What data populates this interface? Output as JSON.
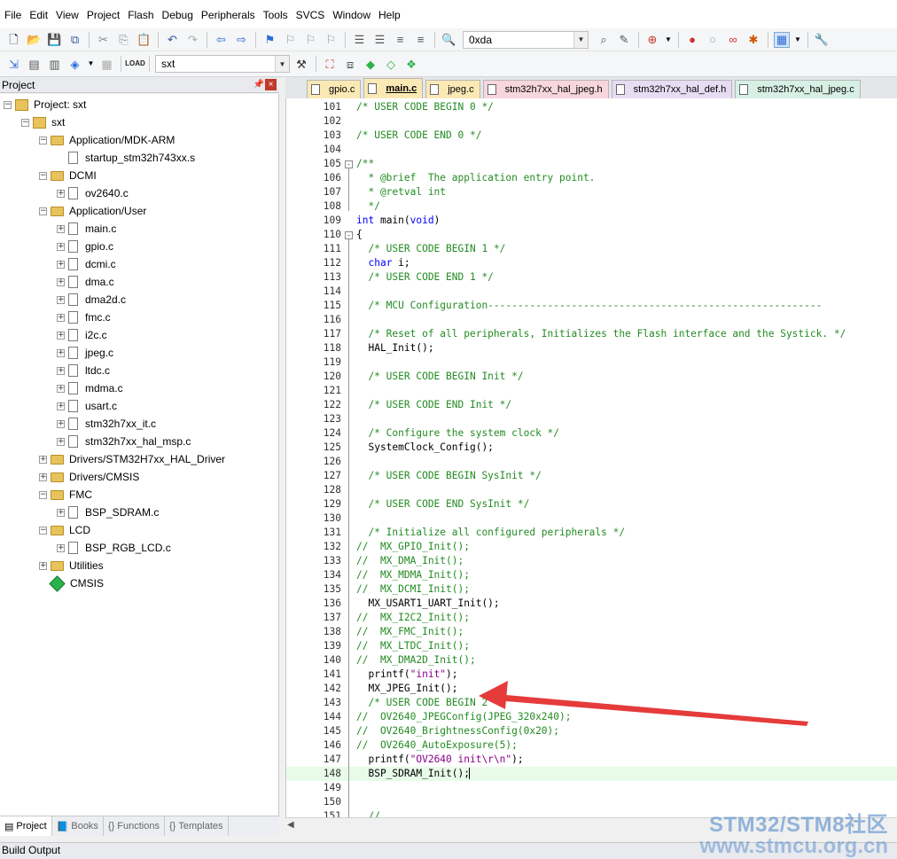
{
  "menu": [
    "File",
    "Edit",
    "View",
    "Project",
    "Flash",
    "Debug",
    "Peripherals",
    "Tools",
    "SVCS",
    "Window",
    "Help"
  ],
  "toolbar": {
    "search_value": "0xda",
    "target_value": "sxt"
  },
  "project_panel": {
    "title": "Project",
    "root": "Project: sxt",
    "target": "sxt",
    "groups": [
      {
        "name": "Application/MDK-ARM",
        "files": [
          "startup_stm32h743xx.s"
        ]
      },
      {
        "name": "DCMI",
        "files": [
          "ov2640.c"
        ]
      },
      {
        "name": "Application/User",
        "files": [
          "main.c",
          "gpio.c",
          "dcmi.c",
          "dma.c",
          "dma2d.c",
          "fmc.c",
          "i2c.c",
          "jpeg.c",
          "ltdc.c",
          "mdma.c",
          "usart.c",
          "stm32h7xx_it.c",
          "stm32h7xx_hal_msp.c"
        ]
      },
      {
        "name": "Drivers/STM32H7xx_HAL_Driver",
        "files": []
      },
      {
        "name": "Drivers/CMSIS",
        "files": []
      },
      {
        "name": "FMC",
        "files": [
          "BSP_SDRAM.c"
        ]
      },
      {
        "name": "LCD",
        "files": [
          "BSP_RGB_LCD.c"
        ]
      },
      {
        "name": "Utilities",
        "files": []
      }
    ],
    "cmsis": "CMSIS",
    "tabs": [
      "Project",
      "Books",
      "Functions",
      "Templates"
    ]
  },
  "build_output": "Build Output",
  "editor_tabs": [
    {
      "label": "gpio.c",
      "color": "#fbe9b5"
    },
    {
      "label": "main.c",
      "color": "#fbe9b5",
      "active": true
    },
    {
      "label": "jpeg.c",
      "color": "#fbe9b5"
    },
    {
      "label": "stm32h7xx_hal_jpeg.h",
      "color": "#f7d6de"
    },
    {
      "label": "stm32h7xx_hal_def.h",
      "color": "#e8dcf3"
    },
    {
      "label": "stm32h7xx_hal_jpeg.c",
      "color": "#d8efe5"
    }
  ],
  "code_lines": [
    {
      "n": "101",
      "t": "/* USER CODE BEGIN 0 */",
      "k": "com"
    },
    {
      "n": "102",
      "t": "",
      "k": "plain"
    },
    {
      "n": "103",
      "t": "/* USER CODE END 0 */",
      "k": "com"
    },
    {
      "n": "104",
      "t": "",
      "k": "plain"
    },
    {
      "n": "105",
      "t": "/**",
      "k": "com",
      "fold": "-"
    },
    {
      "n": "106",
      "t": "  * @brief  The application entry point.",
      "k": "com"
    },
    {
      "n": "107",
      "t": "  * @retval int",
      "k": "com"
    },
    {
      "n": "108",
      "t": "  */",
      "k": "com"
    },
    {
      "n": "109",
      "t": "int main(void)",
      "k": "mixmain"
    },
    {
      "n": "110",
      "t": "{",
      "k": "plain",
      "fold": "-"
    },
    {
      "n": "111",
      "t": "  /* USER CODE BEGIN 1 */",
      "k": "com"
    },
    {
      "n": "112",
      "t": "  char i;",
      "k": "mixchar"
    },
    {
      "n": "113",
      "t": "  /* USER CODE END 1 */",
      "k": "com"
    },
    {
      "n": "114",
      "t": "",
      "k": "plain"
    },
    {
      "n": "115",
      "t": "  /* MCU Configuration--------------------------------------------------------",
      "k": "com"
    },
    {
      "n": "116",
      "t": "",
      "k": "plain"
    },
    {
      "n": "117",
      "t": "  /* Reset of all peripherals, Initializes the Flash interface and the Systick. */",
      "k": "com"
    },
    {
      "n": "118",
      "t": "  HAL_Init();",
      "k": "plain"
    },
    {
      "n": "119",
      "t": "",
      "k": "plain"
    },
    {
      "n": "120",
      "t": "  /* USER CODE BEGIN Init */",
      "k": "com"
    },
    {
      "n": "121",
      "t": "",
      "k": "plain"
    },
    {
      "n": "122",
      "t": "  /* USER CODE END Init */",
      "k": "com"
    },
    {
      "n": "123",
      "t": "",
      "k": "plain"
    },
    {
      "n": "124",
      "t": "  /* Configure the system clock */",
      "k": "com"
    },
    {
      "n": "125",
      "t": "  SystemClock_Config();",
      "k": "plain"
    },
    {
      "n": "126",
      "t": "",
      "k": "plain"
    },
    {
      "n": "127",
      "t": "  /* USER CODE BEGIN SysInit */",
      "k": "com"
    },
    {
      "n": "128",
      "t": "",
      "k": "plain"
    },
    {
      "n": "129",
      "t": "  /* USER CODE END SysInit */",
      "k": "com"
    },
    {
      "n": "130",
      "t": "",
      "k": "plain"
    },
    {
      "n": "131",
      "t": "  /* Initialize all configured peripherals */",
      "k": "com"
    },
    {
      "n": "132",
      "t": "//  MX_GPIO_Init();",
      "k": "com"
    },
    {
      "n": "133",
      "t": "//  MX_DMA_Init();",
      "k": "com"
    },
    {
      "n": "134",
      "t": "//  MX_MDMA_Init();",
      "k": "com"
    },
    {
      "n": "135",
      "t": "//  MX_DCMI_Init();",
      "k": "com"
    },
    {
      "n": "136",
      "t": "  MX_USART1_UART_Init();",
      "k": "plain"
    },
    {
      "n": "137",
      "t": "//  MX_I2C2_Init();",
      "k": "com"
    },
    {
      "n": "138",
      "t": "//  MX_FMC_Init();",
      "k": "com"
    },
    {
      "n": "139",
      "t": "//  MX_LTDC_Init();",
      "k": "com"
    },
    {
      "n": "140",
      "t": "//  MX_DMA2D_Init();",
      "k": "com"
    },
    {
      "n": "141",
      "t": "  printf(\"init\");",
      "k": "printf1"
    },
    {
      "n": "142",
      "t": "  MX_JPEG_Init();",
      "k": "plain"
    },
    {
      "n": "143",
      "t": "  /* USER CODE BEGIN 2 */",
      "k": "com"
    },
    {
      "n": "144",
      "t": "//  OV2640_JPEGConfig(JPEG_320x240);",
      "k": "com"
    },
    {
      "n": "145",
      "t": "//  OV2640_BrightnessConfig(0x20);",
      "k": "com"
    },
    {
      "n": "146",
      "t": "//  OV2640_AutoExposure(5);",
      "k": "com"
    },
    {
      "n": "147",
      "t": "  printf(\"OV2640 init\\r\\n\");",
      "k": "printf2"
    },
    {
      "n": "148",
      "t": "  BSP_SDRAM_Init();",
      "k": "plain",
      "current": true
    },
    {
      "n": "149",
      "t": "",
      "k": "plain"
    },
    {
      "n": "150",
      "t": "",
      "k": "plain"
    },
    {
      "n": "151",
      "t": "  //",
      "k": "com"
    }
  ],
  "watermark": {
    "line1": "STM32/STM8社区",
    "line2": "www.stmcu.org.cn"
  },
  "colors": {
    "comment": "#228b22",
    "keyword": "#0000ff",
    "string": "#8b008b",
    "arrow": "#e53b3b",
    "current_line": "#e8fbe8"
  }
}
